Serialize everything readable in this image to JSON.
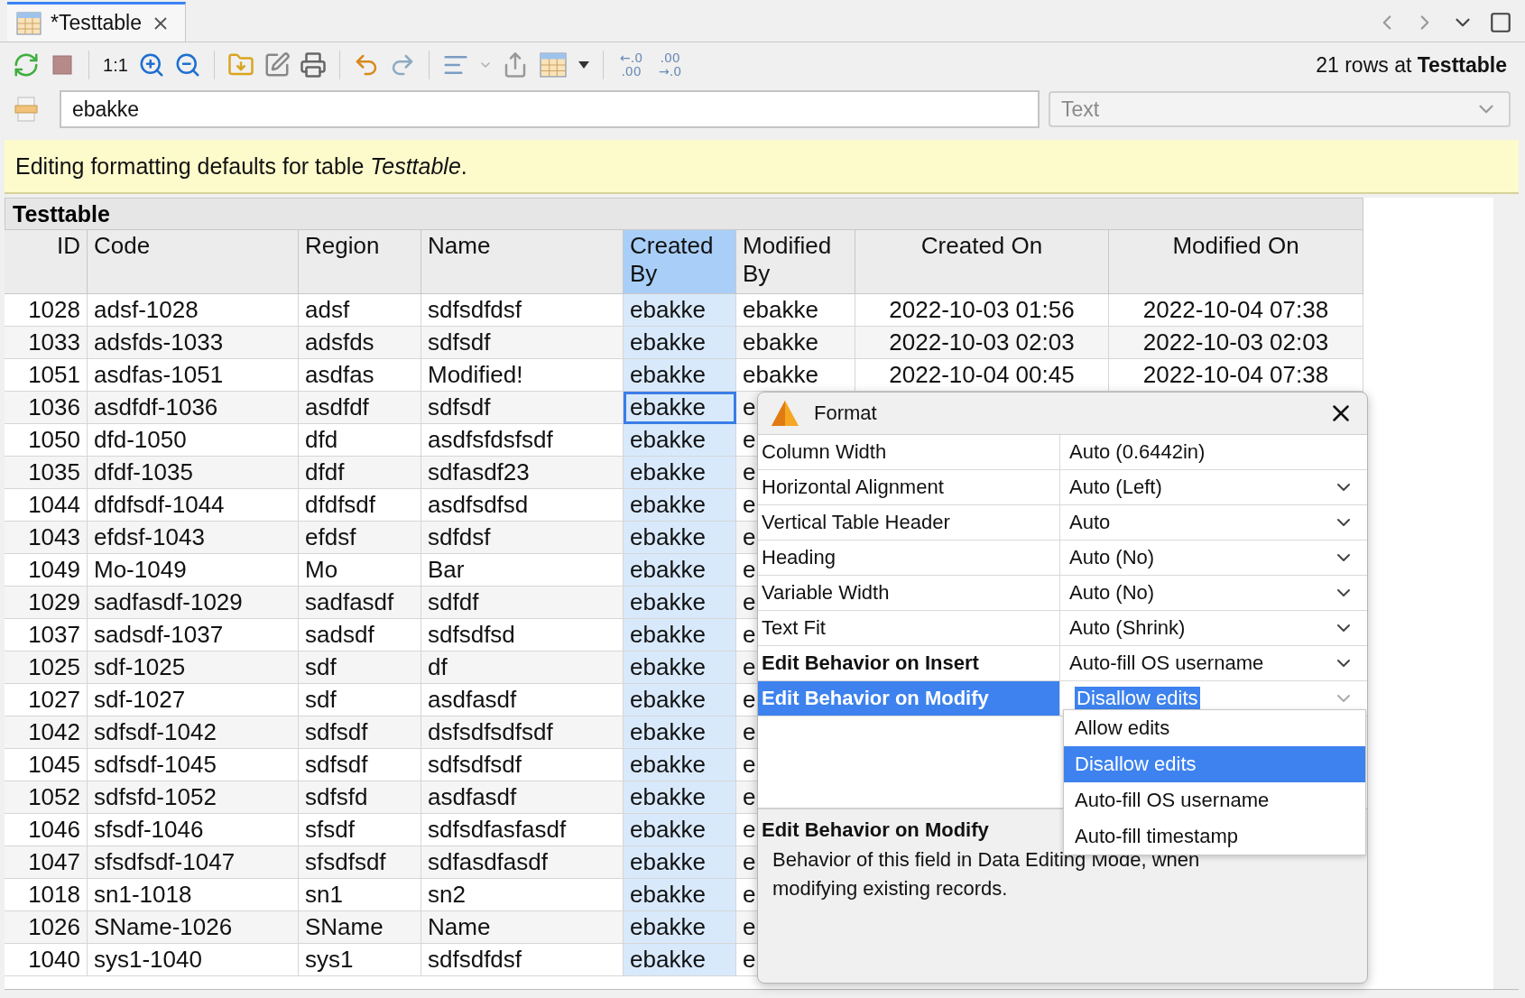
{
  "tab": {
    "title": "*Testtable",
    "selected": true
  },
  "toolbar": [
    {
      "kind": "refresh"
    },
    {
      "kind": "stop"
    },
    {
      "kind": "separator"
    },
    {
      "kind": "text",
      "label": "1:1"
    },
    {
      "kind": "zoom-in"
    },
    {
      "kind": "zoom-out"
    },
    {
      "kind": "separator"
    },
    {
      "kind": "open"
    },
    {
      "kind": "edit"
    },
    {
      "kind": "print"
    },
    {
      "kind": "separator"
    },
    {
      "kind": "undo"
    },
    {
      "kind": "redo"
    },
    {
      "kind": "separator"
    },
    {
      "kind": "align"
    },
    {
      "kind": "caret"
    },
    {
      "kind": "export"
    },
    {
      "kind": "table"
    },
    {
      "kind": "caret-dark"
    },
    {
      "kind": "separator"
    },
    {
      "kind": "decimal",
      "top": "←.0",
      "bottom": ".00"
    },
    {
      "kind": "decimal",
      "top": ".00",
      "bottom": "→.0"
    }
  ],
  "status": "21 rows at **Testtable**",
  "filter": {
    "value": "ebakke",
    "type": {
      "value": "Text",
      "disabled": true
    }
  },
  "banner": "Editing formatting defaults for table *Testtable*.",
  "table": {
    "title": "Testtable",
    "columns": [
      {
        "label": "ID",
        "selected": false
      },
      {
        "label": "Code",
        "selected": false
      },
      {
        "label": "Region",
        "selected": false
      },
      {
        "label": "Name",
        "selected": false
      },
      {
        "label": "Created By",
        "selected": true
      },
      {
        "label": "Modified By",
        "selected": false
      },
      {
        "label": "Created On",
        "selected": false
      },
      {
        "label": "Modified On",
        "selected": false
      }
    ],
    "rows": [
      {
        "cells": [
          "1028",
          "adsf-1028",
          "adsf",
          "sdfsdfdsf",
          "ebakke",
          "ebakke",
          "2022-10-03 01:56",
          "2022-10-04 07:38"
        ],
        "selected": false
      },
      {
        "cells": [
          "1033",
          "adsfds-1033",
          "adsfds",
          "sdfsdf",
          "ebakke",
          "ebakke",
          "2022-10-03 02:03",
          "2022-10-03 02:03"
        ],
        "selected": false
      },
      {
        "cells": [
          "1051",
          "asdfas-1051",
          "asdfas",
          "Modified!",
          "ebakke",
          "ebakke",
          "2022-10-04 00:45",
          "2022-10-04 07:38"
        ],
        "selected": false
      },
      {
        "cells": [
          "1036",
          "asdfdf-1036",
          "asdfdf",
          "sdfsdf",
          "ebakke",
          "e"
        ],
        "selected": true
      },
      {
        "cells": [
          "1050",
          "dfd-1050",
          "dfd",
          "asdfsfdsfsdf",
          "ebakke",
          "e"
        ],
        "selected": false
      },
      {
        "cells": [
          "1035",
          "dfdf-1035",
          "dfdf",
          "sdfasdf23",
          "ebakke",
          "e"
        ],
        "selected": false
      },
      {
        "cells": [
          "1044",
          "dfdfsdf-1044",
          "dfdfsdf",
          "asdfsdfsd",
          "ebakke",
          "e"
        ],
        "selected": false
      },
      {
        "cells": [
          "1043",
          "efdsf-1043",
          "efdsf",
          "sdfdsf",
          "ebakke",
          "e"
        ],
        "selected": false
      },
      {
        "cells": [
          "1049",
          "Mo-1049",
          "Mo",
          "Bar",
          "ebakke",
          "e"
        ],
        "selected": false
      },
      {
        "cells": [
          "1029",
          "sadfasdf-1029",
          "sadfasdf",
          "sdfdf",
          "ebakke",
          "e"
        ],
        "selected": false
      },
      {
        "cells": [
          "1037",
          "sadsdf-1037",
          "sadsdf",
          "sdfsdfsd",
          "ebakke",
          "e"
        ],
        "selected": false
      },
      {
        "cells": [
          "1025",
          "sdf-1025",
          "sdf",
          "df",
          "ebakke",
          "e"
        ],
        "selected": false
      },
      {
        "cells": [
          "1027",
          "sdf-1027",
          "sdf",
          "asdfasdf",
          "ebakke",
          "e"
        ],
        "selected": false
      },
      {
        "cells": [
          "1042",
          "sdfsdf-1042",
          "sdfsdf",
          "dsfsdfsdfsdf",
          "ebakke",
          "e"
        ],
        "selected": false
      },
      {
        "cells": [
          "1045",
          "sdfsdf-1045",
          "sdfsdf",
          "sdfsdfsdf",
          "ebakke",
          "e"
        ],
        "selected": false
      },
      {
        "cells": [
          "1052",
          "sdfsfd-1052",
          "sdfsfd",
          "asdfasdf",
          "ebakke",
          "e"
        ],
        "selected": false
      },
      {
        "cells": [
          "1046",
          "sfsdf-1046",
          "sfsdf",
          "sdfsdfasfasdf",
          "ebakke",
          "e"
        ],
        "selected": false
      },
      {
        "cells": [
          "1047",
          "sfsdfsdf-1047",
          "sfsdfsdf",
          "sdfasdfasdf",
          "ebakke",
          "e"
        ],
        "selected": false
      },
      {
        "cells": [
          "1018",
          "sn1-1018",
          "sn1",
          "sn2",
          "ebakke",
          "e"
        ],
        "selected": false
      },
      {
        "cells": [
          "1026",
          "SName-1026",
          "SName",
          "Name",
          "ebakke",
          "e"
        ],
        "selected": false
      },
      {
        "cells": [
          "1040",
          "sys1-1040",
          "sys1",
          "sdfsdfdsf",
          "ebakke",
          "e"
        ],
        "selected": false
      }
    ]
  },
  "format": {
    "title": "Format",
    "properties": [
      {
        "label": "Column Width",
        "value": "Auto (0.6442in)",
        "dropdown": false,
        "bold": false,
        "selected": false
      },
      {
        "label": "Horizontal Alignment",
        "value": "Auto (Left)",
        "dropdown": true,
        "bold": false,
        "selected": false
      },
      {
        "label": "Vertical Table Header",
        "value": "Auto",
        "dropdown": true,
        "bold": false,
        "selected": false
      },
      {
        "label": "Heading",
        "value": "Auto (No)",
        "dropdown": true,
        "bold": false,
        "selected": false
      },
      {
        "label": "Variable Width",
        "value": "Auto (No)",
        "dropdown": true,
        "bold": false,
        "selected": false
      },
      {
        "label": "Text Fit",
        "value": "Auto (Shrink)",
        "dropdown": true,
        "bold": false,
        "selected": false
      },
      {
        "label": "Edit Behavior on Insert",
        "value": "Auto-fill OS username",
        "dropdown": true,
        "bold": true,
        "selected": false
      },
      {
        "label": "Edit Behavior on Modify",
        "value": "Disallow edits",
        "dropdown": true,
        "bold": true,
        "selected": true
      }
    ],
    "options": [
      {
        "label": "Allow edits",
        "selected": false
      },
      {
        "label": "Disallow edits",
        "selected": true
      },
      {
        "label": "Auto-fill OS username",
        "selected": false
      },
      {
        "label": "Auto-fill timestamp",
        "selected": false
      }
    ],
    "description": {
      "title": "Edit Behavior on Modify",
      "text": "Behavior of this field in Data Editing Mode, when modifying existing records."
    }
  }
}
